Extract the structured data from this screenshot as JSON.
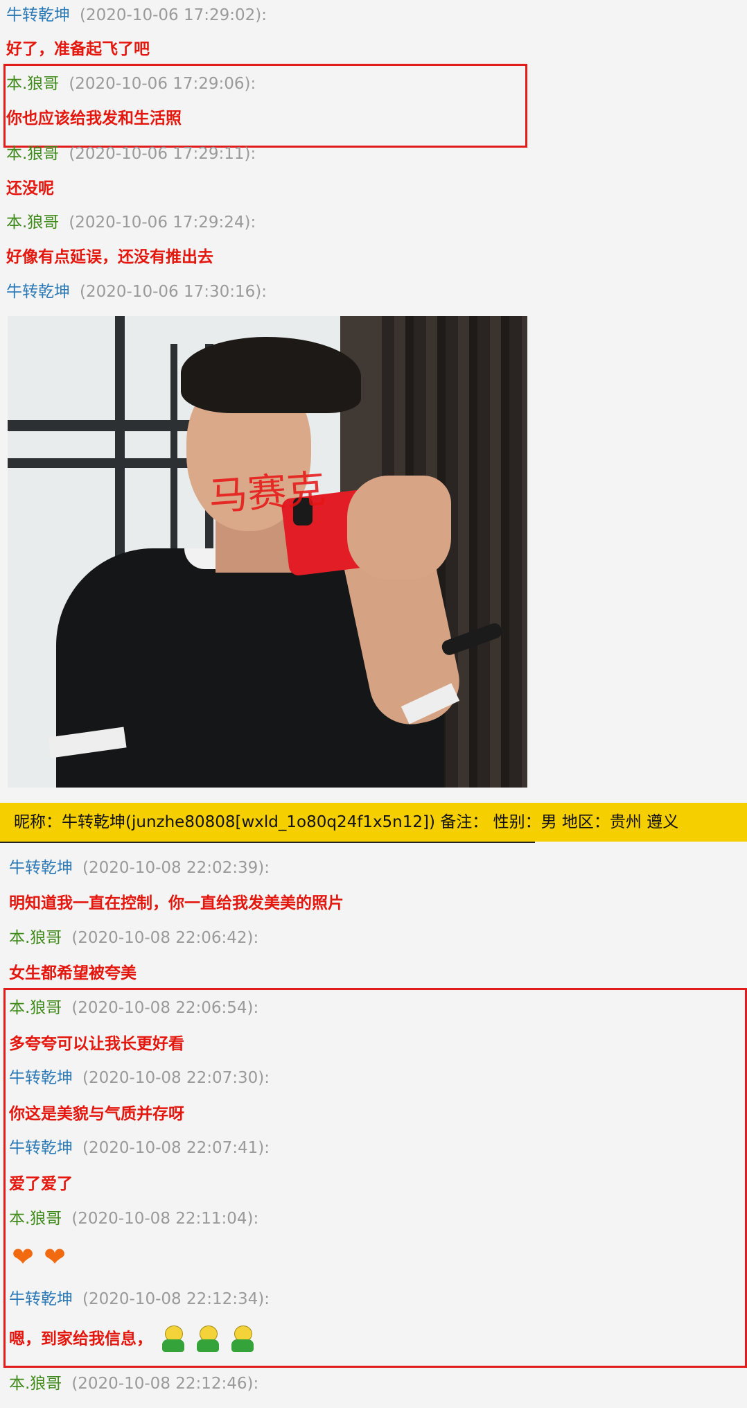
{
  "messages_top": [
    {
      "sender": "牛转乾坤",
      "time": "(2020-10-06 17:29:02):",
      "text": "好了，准备起飞了吧"
    },
    {
      "sender": "本.狼哥",
      "time": "(2020-10-06 17:29:06):",
      "text": "你也应该给我发和生活照"
    },
    {
      "sender": "本.狼哥",
      "time": "(2020-10-06 17:29:11):",
      "text": "还没呢"
    },
    {
      "sender": "本.狼哥",
      "time": "(2020-10-06 17:29:24):",
      "text": "好像有点延误，还没有推出去"
    },
    {
      "sender": "牛转乾坤",
      "time": "(2020-10-06 17:30:16):"
    }
  ],
  "photo": {
    "watermark": "马赛克"
  },
  "profile_bar": {
    "text": "昵称：牛转乾坤(junzhe80808[wxld_1o80q24f1x5n12])  备注：  性别：男  地区：贵州 遵义"
  },
  "messages_bottom": [
    {
      "sender": "牛转乾坤",
      "time": "(2020-10-08 22:02:39):",
      "text": "明知道我一直在控制，你一直给我发美美的照片"
    },
    {
      "sender": "本.狼哥",
      "time": "(2020-10-08 22:06:42):",
      "text": "女生都希望被夸美"
    },
    {
      "sender": "本.狼哥",
      "time": "(2020-10-08 22:06:54):",
      "text": "多夸夸可以让我长更好看"
    },
    {
      "sender": "牛转乾坤",
      "time": "(2020-10-08 22:07:30):",
      "text": "你这是美貌与气质并存呀"
    },
    {
      "sender": "牛转乾坤",
      "time": "(2020-10-08 22:07:41):",
      "text": "爱了爱了"
    },
    {
      "sender": "本.狼哥",
      "time": "(2020-10-08 22:11:04):"
    },
    {
      "sender": "牛转乾坤",
      "time": "(2020-10-08 22:12:34):",
      "text": "嗯，到家给我信息，"
    },
    {
      "sender": "本.狼哥",
      "time": "(2020-10-08 22:12:46):"
    }
  ],
  "emoji": {
    "hearts": "heart-emoji",
    "waving": "green-figure-emoji"
  },
  "colors": {
    "highlight": "#e21b1b",
    "message_text": "#e3170d",
    "profile_bar": "#f6cf00"
  }
}
